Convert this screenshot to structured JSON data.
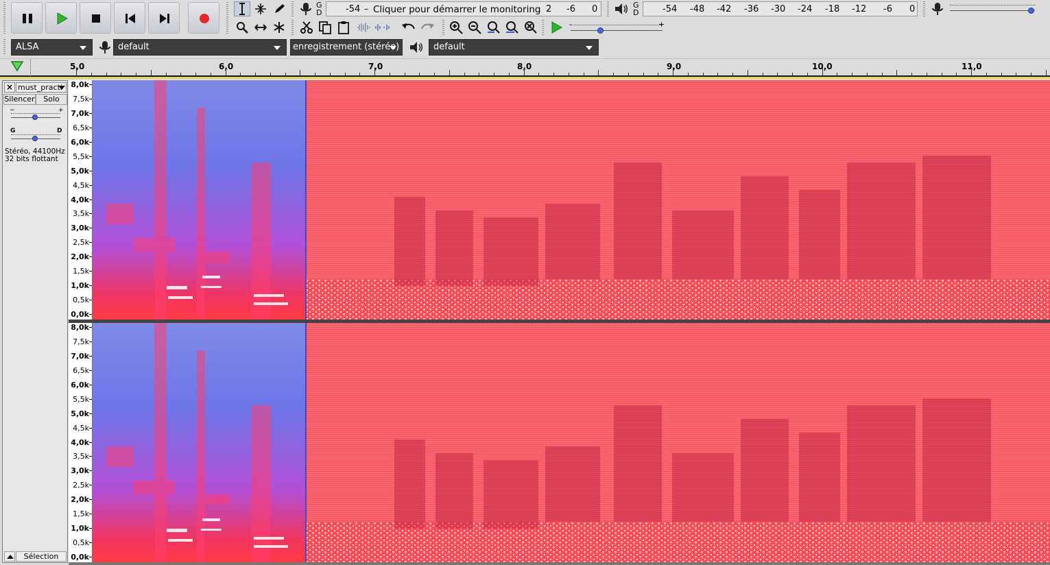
{
  "transport": {
    "pause": "pause-icon",
    "play": "play-icon",
    "stop": "stop-icon",
    "skip_start": "skip-start-icon",
    "skip_end": "skip-end-icon",
    "record": "record-icon"
  },
  "record_meter": {
    "gd": [
      "G",
      "D"
    ],
    "ticks": [
      "-54",
      "2",
      "-6",
      "0"
    ],
    "hint": "Cliquer pour démarrer le monitoring"
  },
  "play_meter": {
    "gd": [
      "G",
      "D"
    ],
    "ticks": [
      "-54",
      "-48",
      "-42",
      "-36",
      "-30",
      "-24",
      "-18",
      "-12",
      "-6",
      "0"
    ]
  },
  "play_speed": {
    "min": "-",
    "max": "+"
  },
  "device": {
    "host": "ALSA",
    "input": "default",
    "channels": "enregistrement (stéréo)",
    "output": "default"
  },
  "ruler": {
    "labels": [
      "5,0",
      "6,0",
      "7,0",
      "8,0",
      "9,0",
      "10,0",
      "11,0"
    ]
  },
  "track": {
    "name": "must_practi",
    "mute": "Silencer",
    "solo": "Solo",
    "gain_min": "−",
    "gain_max": "+",
    "pan_left": "G",
    "pan_right": "D",
    "info1": "Stéréo, 44100Hz",
    "info2": "32 bits flottant",
    "select": "Sélection"
  },
  "freq_labels": [
    "8,0k",
    "7,5k",
    "7,0k",
    "6,5k",
    "6,0k",
    "5,5k",
    "5,0k",
    "4,5k",
    "4,0k",
    "3,5k",
    "3,0k",
    "2,5k",
    "2,0k",
    "1,5k",
    "1,0k",
    "0,5k",
    "0,0k"
  ],
  "colors": {
    "spec_low": "#6a7ee8",
    "spec_high": "#ff3a44",
    "spec_red_bg": "#f25c64",
    "hidden_text": "#c42848"
  }
}
